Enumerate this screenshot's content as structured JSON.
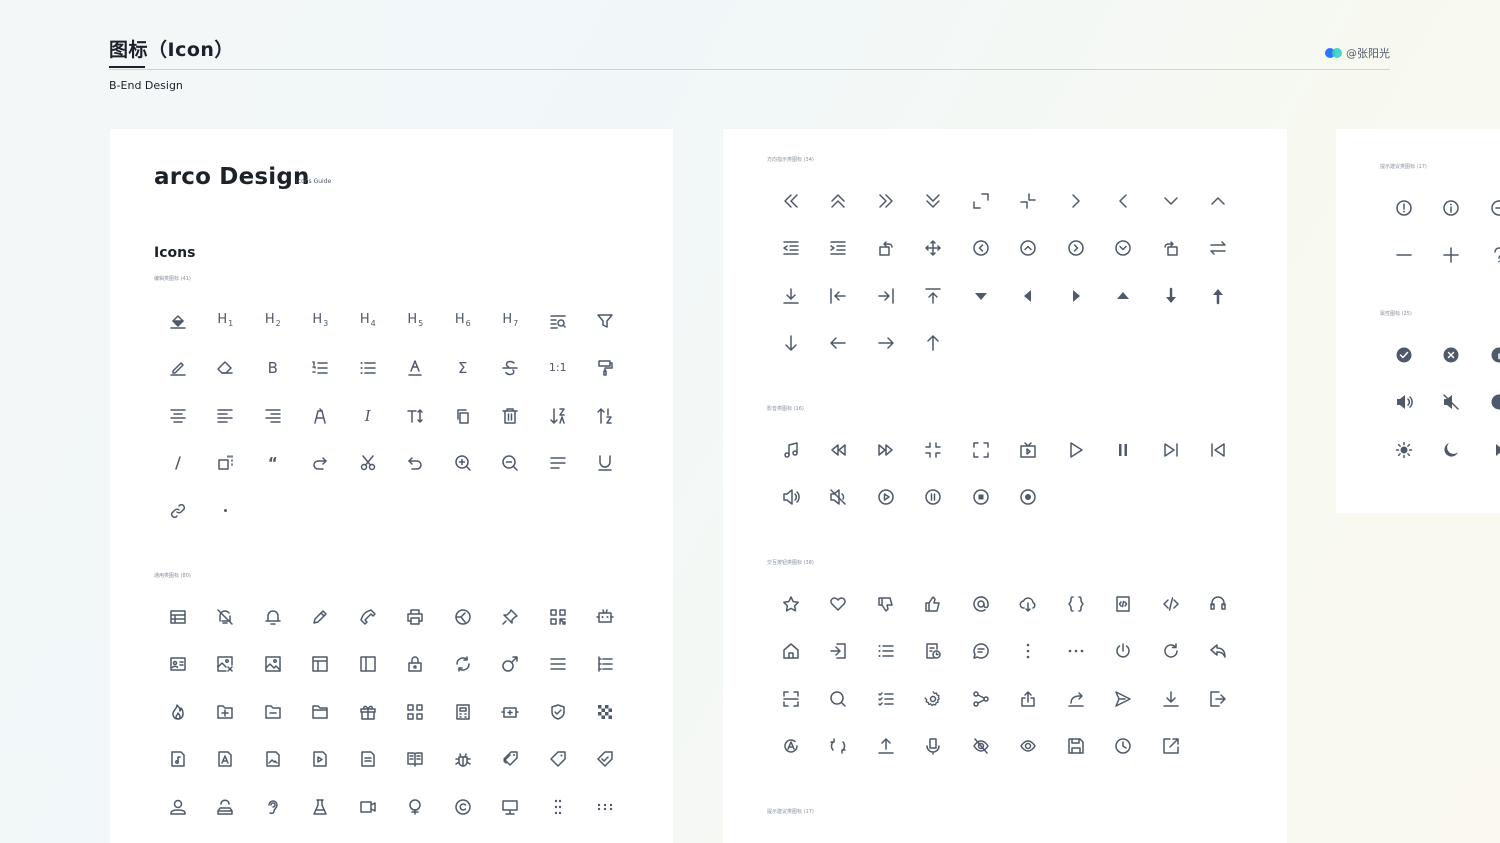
{
  "header": {
    "title": "图标（Icon）",
    "subtitle": "B-End Design",
    "author": "@张阳光"
  },
  "panels": [
    {
      "brand": "arco Design",
      "brand_sub": "Icons Guide",
      "heading": "Icons",
      "sections": [
        {
          "label": "编辑类图标 (41)",
          "icons": [
            "fill-icon",
            "h1-icon",
            "h2-icon",
            "h3-icon",
            "h4-icon",
            "h5-icon",
            "h6-icon",
            "h7-icon",
            "find-replace-icon",
            "filter-icon",
            "edit-icon",
            "eraser-icon",
            "bold-icon",
            "ordered-list-icon",
            "unordered-list-icon",
            "font-colors-icon",
            "formula-icon",
            "strikethrough-icon",
            "original-size-icon",
            "brush-icon",
            "align-center-icon",
            "align-left-icon",
            "align-right-icon",
            "bg-colors-icon",
            "italic-icon",
            "line-height-icon",
            "copy-icon",
            "delete-icon",
            "sort-ascending-icon",
            "sort-descending-icon",
            "oblique-line-icon",
            "scale-icon",
            "quote-icon",
            "redo-icon",
            "scissor-icon",
            "undo-icon",
            "zoom-in-icon",
            "zoom-out-icon",
            "paragraph-icon",
            "underline-icon",
            "link-icon",
            "dot-icon"
          ]
        },
        {
          "label": "通用类图标 (80)",
          "icons": [
            "table-icon",
            "bell-off-icon",
            "bell-icon",
            "pen-icon",
            "phone-icon",
            "printer-icon",
            "safe-icon",
            "pushpin-icon",
            "qrcode-icon",
            "robot-icon",
            "idcard-icon",
            "image-close-icon",
            "image-icon",
            "layout-icon",
            "layers-icon",
            "lock-icon",
            "loop-icon",
            "man-icon",
            "menu-icon",
            "ordered-list-alt-icon",
            "fire-icon",
            "folder-add-icon",
            "folder-delete-icon",
            "folder-icon",
            "gift-icon",
            "apps-icon",
            "calculator-icon",
            "robot-add-icon",
            "safe-shield-icon",
            "mosaic-icon",
            "file-audio-icon",
            "file-pdf-icon",
            "file-image-icon",
            "file-video-icon",
            "file-icon",
            "book-icon",
            "bug-icon",
            "tags-icon",
            "tag-icon",
            "tag-check-icon",
            "user-icon",
            "user-group-icon",
            "ear-icon",
            "experiment-icon",
            "video-camera-icon",
            "woman-icon",
            "copyright-icon",
            "desktop-icon",
            "drag-dot-vertical-icon",
            "drag-dot-icon"
          ]
        }
      ]
    },
    {
      "sections": [
        {
          "label": "方向指示类图标 (34)",
          "icons": [
            "double-left-icon",
            "double-up-icon",
            "double-right-icon",
            "double-down-icon",
            "expand-icon",
            "shrink-icon",
            "right-icon",
            "left-icon",
            "down-icon",
            "up-icon",
            "menu-fold-icon",
            "menu-unfold-icon",
            "rotate-left-icon",
            "drag-arrow-icon",
            "left-circle-icon",
            "up-circle-icon",
            "right-circle-icon",
            "down-circle-icon",
            "rotate-right-icon",
            "swap-icon",
            "to-bottom-icon",
            "to-left-icon",
            "to-right-icon",
            "to-top-icon",
            "caret-down-icon",
            "caret-left-icon",
            "caret-right-icon",
            "caret-up-icon",
            "arrow-fall-icon",
            "arrow-rise-icon",
            "arrow-down-icon",
            "arrow-left-icon",
            "arrow-right-icon",
            "arrow-up-icon"
          ]
        },
        {
          "label": "影音类图标 (16)",
          "icons": [
            "music-icon",
            "backward-icon",
            "forward-icon",
            "fullscreen-exit-icon",
            "fullscreen-icon",
            "live-broadcast-icon",
            "play-arrow-icon",
            "pause-icon",
            "skip-next-icon",
            "skip-previous-icon",
            "sound-icon",
            "mute-icon",
            "play-circle-icon",
            "pause-circle-icon",
            "stop-circle-icon",
            "record-icon"
          ]
        },
        {
          "label": "交互按钮类图标 (38)",
          "icons": [
            "star-icon",
            "heart-icon",
            "thumb-down-icon",
            "thumb-up-icon",
            "at-icon",
            "cloud-download-icon",
            "code-block-icon",
            "code-square-icon",
            "code-icon",
            "customer-service-icon",
            "home-icon",
            "import-icon",
            "list-icon",
            "history-icon",
            "message-icon",
            "more-vertical-icon",
            "more-icon",
            "poweroff-icon",
            "refresh-icon",
            "reply-icon",
            "scan-icon",
            "search-icon",
            "select-all-icon",
            "settings-icon",
            "share-internal-icon",
            "share-alt-icon",
            "share-external-icon",
            "send-icon",
            "download-icon",
            "export-icon",
            "translate-icon",
            "sync-icon",
            "upload-icon",
            "voice-icon",
            "eye-invisible-icon",
            "eye-icon",
            "save-icon",
            "clock-circle-icon",
            "launch-icon"
          ]
        },
        {
          "label": "提示建议类图标 (17)"
        }
      ]
    },
    {
      "sections": [
        {
          "label": "提示建议类图标 (17)",
          "icons": [
            "exclamation-circle-icon",
            "info-circle-icon",
            "minus-circle-icon",
            "minus-icon",
            "plus-icon",
            "question-icon"
          ]
        },
        {
          "label": "属性图标 (25)",
          "icons": [
            "check-circle-fill-icon",
            "close-circle-fill-icon",
            "info-circle-fill-icon",
            "sound-fill-icon",
            "mute-fill-icon",
            "play-circle-fill-icon",
            "sun-fill-icon",
            "moon-fill-icon",
            "caret-right-fill-icon"
          ]
        }
      ]
    }
  ]
}
